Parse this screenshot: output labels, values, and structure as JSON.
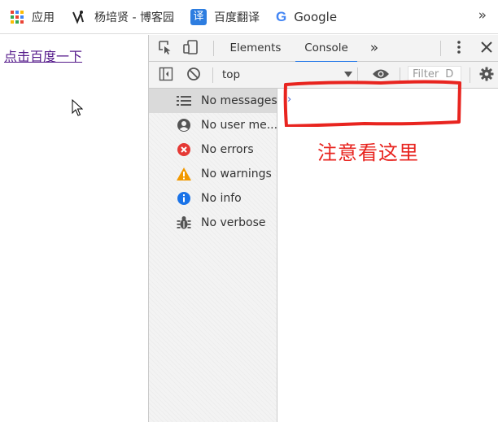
{
  "bookmarks": {
    "items": [
      {
        "label": "应用",
        "icon": "apps-grid-icon"
      },
      {
        "label": "杨培贤 - 博客园",
        "icon": "blog-logo-icon"
      },
      {
        "label": "百度翻译",
        "icon": "translate-icon",
        "icon_text": "译"
      },
      {
        "label": "Google",
        "icon": "google-g-icon",
        "icon_text": "G"
      }
    ],
    "more": "»"
  },
  "page": {
    "link_text": "点击百度一下"
  },
  "devtools": {
    "tabs": {
      "elements": "Elements",
      "console": "Console",
      "more": "»"
    },
    "toolbar": {
      "context": "top",
      "filter_placeholder": "Filter",
      "filter_tail": "D"
    },
    "sidebar": {
      "items": [
        {
          "label": "No messages",
          "icon": "list-icon"
        },
        {
          "label": "No user me...",
          "icon": "user-icon"
        },
        {
          "label": "No errors",
          "icon": "error-icon"
        },
        {
          "label": "No warnings",
          "icon": "warning-icon"
        },
        {
          "label": "No info",
          "icon": "info-icon"
        },
        {
          "label": "No verbose",
          "icon": "bug-icon"
        }
      ]
    },
    "console": {
      "prompt": "›"
    }
  },
  "annotation": {
    "text": "注意看这里",
    "color": "#e8241f"
  },
  "colors": {
    "accent": "#1a73e8",
    "link": "#551a8b",
    "error": "#e53935",
    "warning": "#f29900",
    "info": "#1a73e8"
  }
}
